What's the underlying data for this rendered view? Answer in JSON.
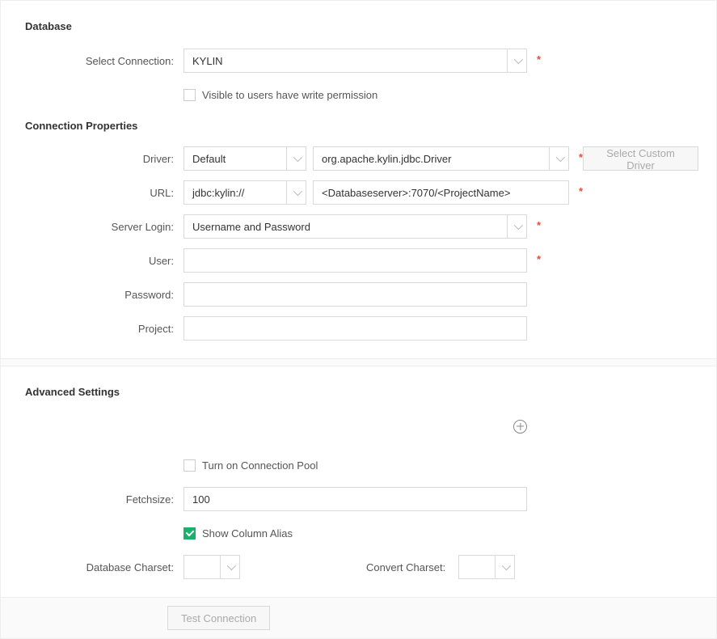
{
  "database": {
    "title": "Database",
    "selectConnection": {
      "label": "Select Connection:",
      "value": "KYLIN"
    },
    "visibleCheckbox": {
      "label": "Visible to users have write permission",
      "checked": false
    }
  },
  "connectionProperties": {
    "title": "Connection Properties",
    "driver": {
      "label": "Driver:",
      "selectorValue": "Default",
      "classValue": "org.apache.kylin.jdbc.Driver"
    },
    "url": {
      "label": "URL:",
      "prefixValue": "jdbc:kylin://",
      "value": "<Databaseserver>:7070/<ProjectName>"
    },
    "serverLogin": {
      "label": "Server Login:",
      "value": "Username and Password"
    },
    "user": {
      "label": "User:",
      "value": ""
    },
    "password": {
      "label": "Password:",
      "value": ""
    },
    "project": {
      "label": "Project:",
      "value": ""
    },
    "customDriverButton": "Select Custom Driver"
  },
  "advanced": {
    "title": "Advanced Settings",
    "connectionPool": {
      "label": "Turn on Connection Pool",
      "checked": false
    },
    "fetchsize": {
      "label": "Fetchsize:",
      "value": "100"
    },
    "showColumnAlias": {
      "label": "Show Column Alias",
      "checked": true
    },
    "dbCharset": {
      "label": "Database Charset:",
      "value": ""
    },
    "convertCharset": {
      "label": "Convert Charset:",
      "value": ""
    }
  },
  "footer": {
    "testConnection": "Test Connection"
  }
}
